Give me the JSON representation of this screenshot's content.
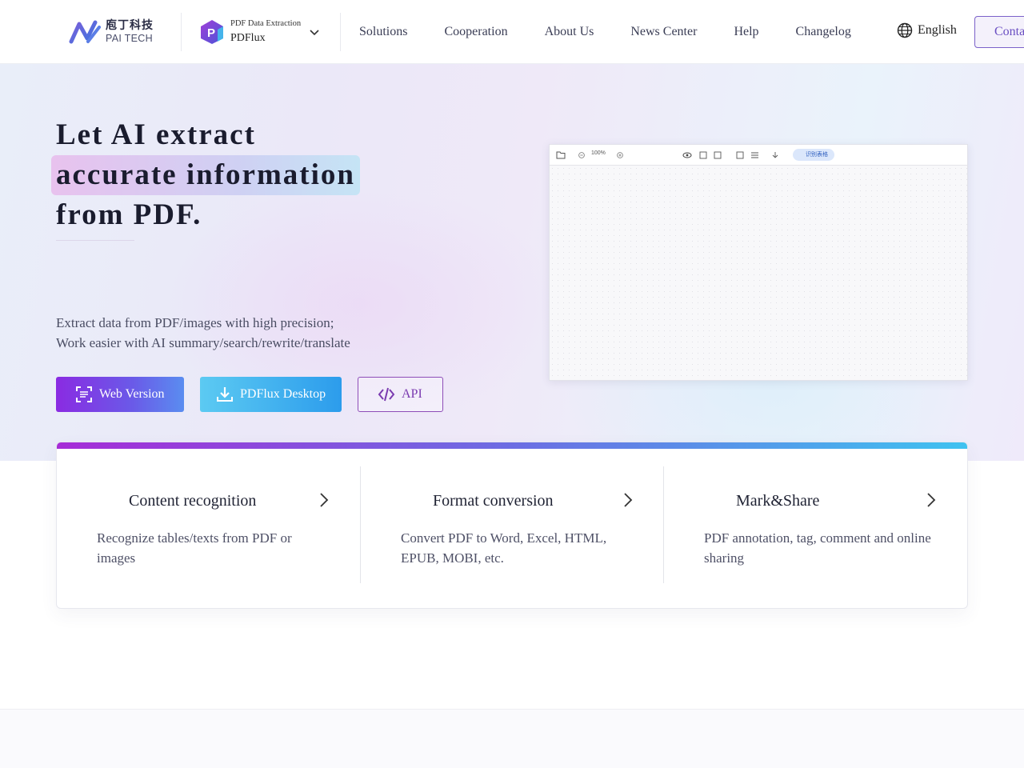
{
  "brand": {
    "logo_cn": "庖丁科技",
    "logo_en": "PAI TECH"
  },
  "product": {
    "subtitle": "PDF Data Extraction",
    "name": "PDFlux",
    "icon_letter": "P"
  },
  "menu": [
    "Solutions",
    "Cooperation",
    "About Us",
    "News Center",
    "Help",
    "Changelog"
  ],
  "language": {
    "label": "English",
    "icon": "globe-icon"
  },
  "contact": {
    "label": "Contact"
  },
  "hero": {
    "title_line1": "Let AI extract",
    "title_line2": "accurate information",
    "title_line3": "from PDF.",
    "desc_line1": "Extract data from PDF/images with high precision;",
    "desc_line2": "Work easier with AI summary/search/rewrite/translate",
    "buttons": {
      "web": "Web Version",
      "desktop": "PDFlux Desktop",
      "api": "API"
    }
  },
  "preview": {
    "zoom": "100%",
    "badge": "识别表格"
  },
  "features": [
    {
      "title": "Content recognition",
      "desc": "Recognize tables/texts from PDF or images"
    },
    {
      "title": "Format conversion",
      "desc": "Convert PDF to Word, Excel, HTML, EPUB, MOBI, etc."
    },
    {
      "title": "Mark&Share",
      "desc": "PDF annotation, tag, comment and online sharing"
    }
  ],
  "colors": {
    "accent_purple": "#8a2be2",
    "accent_blue": "#2c9cec",
    "text_dark": "#1f2233"
  }
}
